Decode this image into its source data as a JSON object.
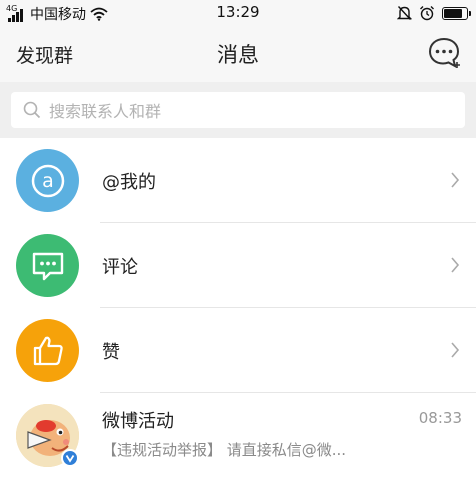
{
  "status_bar": {
    "network": "4G",
    "carrier": "中国移动",
    "time": "13:29",
    "battery_level": 0.85
  },
  "nav": {
    "left": "发现群",
    "title": "消息"
  },
  "search": {
    "placeholder": "搜索联系人和群"
  },
  "list": {
    "items": [
      {
        "label": "@我的",
        "icon": "at-icon",
        "color": "#5bb0e0"
      },
      {
        "label": "评论",
        "icon": "comment-icon",
        "color": "#3dbb73"
      },
      {
        "label": "赞",
        "icon": "thumbs-up-icon",
        "color": "#f6a20a"
      }
    ],
    "message": {
      "name": "微博活动",
      "time": "08:33",
      "preview": "【违规活动举报】 请直接私信@微..."
    }
  },
  "colors": {
    "nav_bg": "#f7f7f7",
    "search_bg": "#efefef",
    "verified": "#2f7fd8"
  }
}
